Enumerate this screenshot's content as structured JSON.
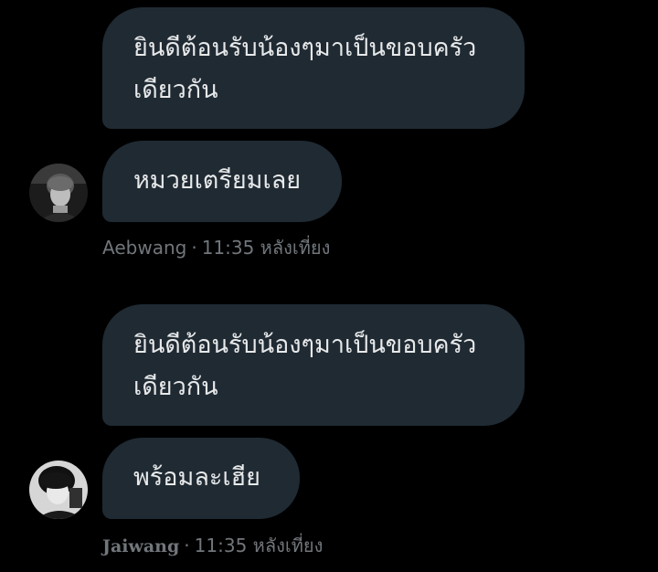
{
  "conversation": [
    {
      "received": "ยินดีต้อนรับน้องๆมาเป็นขอบครัวเดียวกัน",
      "reply": "หมวยเตรียมเลย",
      "sender": "Aebwang",
      "time": "11:35 หลังเที่ยง",
      "avatar_icon": "user-photo"
    },
    {
      "received": "ยินดีต้อนรับน้องๆมาเป็นขอบครัวเดียวกัน",
      "reply": "พร้อมละเฮีย",
      "sender": "Jaiwang",
      "time": "11:35 หลังเที่ยง",
      "avatar_icon": "user-photo"
    }
  ],
  "separator": "·",
  "colors": {
    "background": "#000000",
    "bubble": "#202a33",
    "text": "#e7e9ea",
    "meta": "#71767b"
  }
}
